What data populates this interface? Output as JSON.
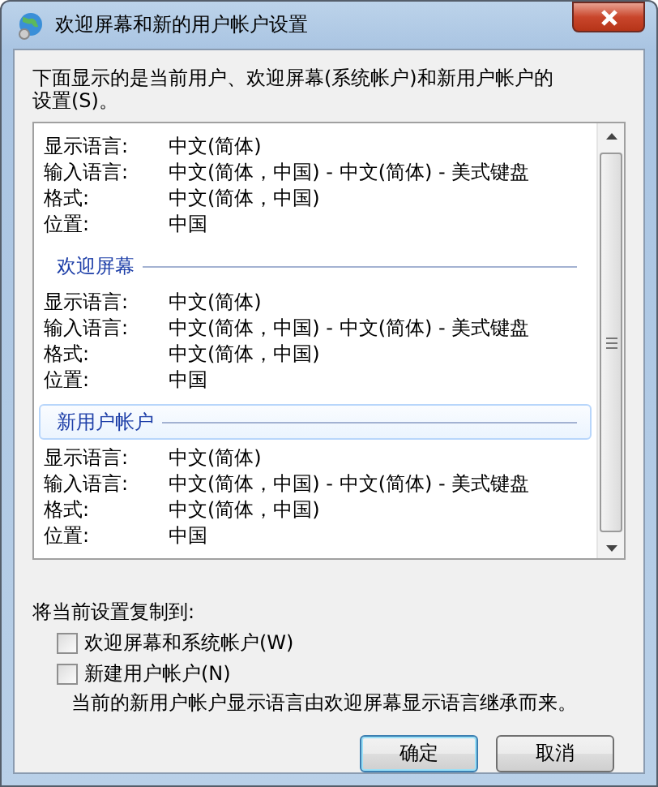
{
  "window": {
    "title": "欢迎屏幕和新的用户帐户设置"
  },
  "intro": "下面显示的是当前用户、欢迎屏幕(系统帐户)和新用户帐户的设置(S)。",
  "sections": [
    {
      "rows": [
        {
          "label": "显示语言:",
          "value": "中文(简体)"
        },
        {
          "label": "输入语言:",
          "value": "中文(简体，中国) - 中文(简体) - 美式键盘"
        },
        {
          "label": "格式:",
          "value": "中文(简体，中国)"
        },
        {
          "label": "位置:",
          "value": "中国"
        }
      ]
    },
    {
      "header": "欢迎屏幕",
      "selected": false,
      "rows": [
        {
          "label": "显示语言:",
          "value": "中文(简体)"
        },
        {
          "label": "输入语言:",
          "value": "中文(简体，中国) - 中文(简体) - 美式键盘"
        },
        {
          "label": "格式:",
          "value": "中文(简体，中国)"
        },
        {
          "label": "位置:",
          "value": "中国"
        }
      ]
    },
    {
      "header": "新用户帐户",
      "selected": true,
      "rows": [
        {
          "label": "显示语言:",
          "value": "中文(简体)"
        },
        {
          "label": "输入语言:",
          "value": "中文(简体，中国) - 中文(简体) - 美式键盘"
        },
        {
          "label": "格式:",
          "value": "中文(简体，中国)"
        },
        {
          "label": "位置:",
          "value": "中国"
        }
      ]
    }
  ],
  "copy_label": "将当前设置复制到:",
  "checkboxes": [
    {
      "label": "欢迎屏幕和系统帐户(W)",
      "checked": false
    },
    {
      "label": "新建用户帐户(N)",
      "checked": false
    }
  ],
  "note": "当前的新用户帐户显示语言由欢迎屏幕显示语言继承而来。",
  "buttons": [
    {
      "label": "确定",
      "kind": "default"
    },
    {
      "label": "取消",
      "kind": "normal"
    }
  ]
}
